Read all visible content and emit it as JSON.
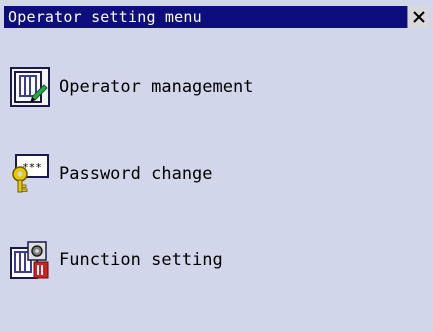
{
  "window": {
    "title": "Operator setting menu"
  },
  "menu": {
    "items": [
      {
        "label": "Operator management",
        "icon": "operator-management-icon"
      },
      {
        "label": "Password change",
        "icon": "key-password-icon",
        "icon_text": "***"
      },
      {
        "label": "Function setting",
        "icon": "function-setting-icon"
      }
    ]
  },
  "colors": {
    "titlebar": "#0d0d7d",
    "background": "#d2d6ea",
    "icon_frame": "#2a2a6a",
    "key": "#e8c800"
  }
}
